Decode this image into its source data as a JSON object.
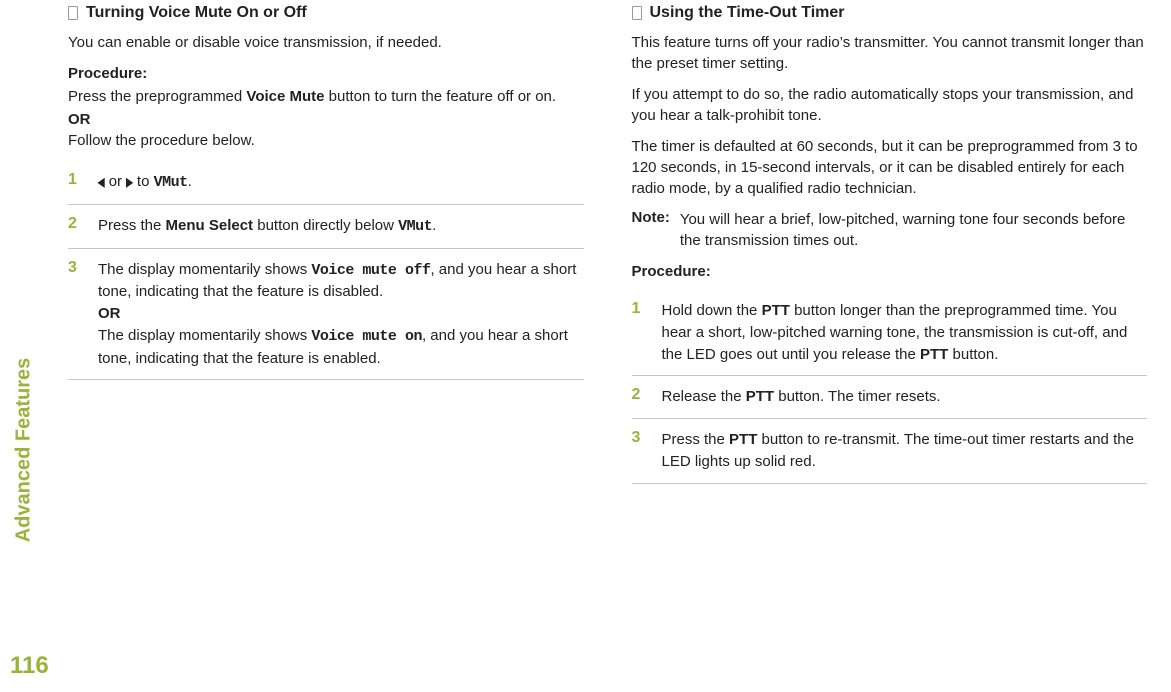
{
  "sidebar": {
    "label": "Advanced Features",
    "page_number": "116"
  },
  "left": {
    "title": "Turning Voice Mute On or Off",
    "intro": "You can enable or disable voice transmission, if needed.",
    "procedure_label": "Procedure:",
    "proc_text_1a": "Press the preprogrammed ",
    "proc_text_1b": "Voice Mute",
    "proc_text_1c": " button to turn the feature off or on.",
    "or": "OR",
    "proc_text_2": "Follow the procedure below.",
    "steps": {
      "s1_or": " or ",
      "s1_to": " to ",
      "s1_target": "VMut",
      "s1_period": ".",
      "s2_a": "Press the ",
      "s2_b": "Menu Select",
      "s2_c": " button directly below ",
      "s2_d": "VMut",
      "s2_e": ".",
      "s3_a": "The display momentarily shows ",
      "s3_off": "Voice mute off",
      "s3_b": ", and you hear a short tone, indicating that the feature is disabled.",
      "s3_or": "OR",
      "s3_c": "The display momentarily shows ",
      "s3_on": "Voice mute on",
      "s3_d": ", and you hear a short tone, indicating that the feature is enabled."
    }
  },
  "right": {
    "title": "Using the Time-Out Timer",
    "p1": "This feature turns off your radio’s transmitter. You cannot transmit longer than the preset timer setting.",
    "p2": "If you attempt to do so, the radio automatically stops your transmission, and you hear a talk-prohibit tone.",
    "p3": "The timer is defaulted at 60 seconds, but it can be preprogrammed from 3 to 120 seconds, in 15-second intervals, or it can be disabled entirely for each radio mode, by a qualified radio technician.",
    "note_label": "Note:",
    "note_body": "You will hear a brief, low-pitched, warning tone four seconds before the transmission times out.",
    "procedure_label": "Procedure:",
    "steps": {
      "s1_a": "Hold down the ",
      "s1_b": "PTT",
      "s1_c": " button longer than the preprogrammed time. You hear a short, low-pitched warning tone, the transmission is cut-off, and the LED goes out until you release the ",
      "s1_d": "PTT",
      "s1_e": " button.",
      "s2_a": "Release the ",
      "s2_b": "PTT",
      "s2_c": " button. The timer resets.",
      "s3_a": "Press the ",
      "s3_b": "PTT",
      "s3_c": " button to re-transmit. The time-out timer restarts and the LED lights up solid red."
    }
  },
  "numbers": {
    "one": "1",
    "two": "2",
    "three": "3"
  },
  "glyphs": {
    "left": "◂",
    "right": "▸"
  }
}
